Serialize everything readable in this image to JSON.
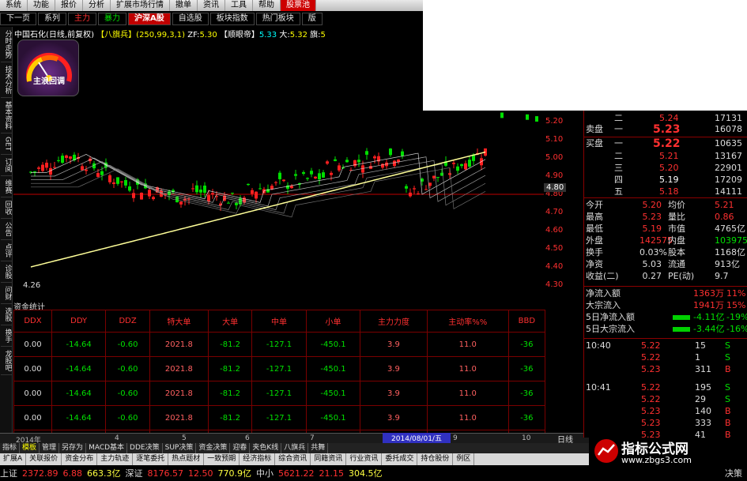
{
  "menu": [
    "系统",
    "功能",
    "报价",
    "分析",
    "扩展市场行情",
    "资讯",
    "工具",
    "帮助",
    "股票池"
  ],
  "menu_extra": [
    "撤单"
  ],
  "tabs": [
    "下一页",
    "系列",
    "自选股",
    "板块指数",
    "热门板块",
    "版"
  ],
  "tab_red": "主力",
  "tab_blue": "暴力",
  "hot_tab": "沪深A股",
  "chart_info": {
    "stock": "中国石化(日线,前复权)",
    "indicator": "【八旗兵】(250,99,3,1)",
    "zf_label": "ZF:",
    "zf_value": "5.30",
    "kai_label": "【顺眼帝】",
    "kai_value": "5.33",
    "big_label": "大:",
    "big_value": "5.32",
    "flag_label": "旗:",
    "flag_value": "5"
  },
  "gauge_label": "主浪回调",
  "left_strip": [
    "分时走势",
    "技术分析",
    "基本资料",
    "GET",
    "订阅",
    "维赛",
    "回收",
    "公告",
    "点评",
    "诊股",
    "问财",
    "选股",
    "换手",
    "龙股吧"
  ],
  "price_scale": [
    "5.20",
    "5.10",
    "5.00",
    "4.90",
    "4.80",
    "4.70",
    "4.60",
    "4.50",
    "4.40",
    "4.30"
  ],
  "price_marker": "4.80",
  "min_price_label": "4.26",
  "fund_header": "资金统计",
  "fund_table": {
    "headers": [
      "DDX",
      "DDY",
      "DDZ",
      "特大单",
      "大单",
      "中单",
      "小单",
      "主力力度",
      "主动率%%",
      "BBD"
    ],
    "rows": [
      [
        "0.00",
        "-14.64",
        "-0.60",
        "2021.8",
        "-81.2",
        "-127.1",
        "-450.1",
        "3.9",
        "11.0",
        "-36"
      ],
      [
        "0.00",
        "-14.64",
        "-0.60",
        "2021.8",
        "-81.2",
        "-127.1",
        "-450.1",
        "3.9",
        "11.0",
        "-36"
      ],
      [
        "0.00",
        "-14.64",
        "-0.60",
        "2021.8",
        "-81.2",
        "-127.1",
        "-450.1",
        "3.9",
        "11.0",
        "-36"
      ],
      [
        "0.00",
        "-14.64",
        "-0.60",
        "2021.8",
        "-81.2",
        "-127.1",
        "-450.1",
        "3.9",
        "11.0",
        "-36"
      ],
      [
        "0.00",
        "-14.64",
        "-0.60",
        "2021.8",
        "-81.2",
        "-127.1",
        "-450.1",
        "3.9",
        "11.0",
        "-36"
      ]
    ]
  },
  "bottom_axis": {
    "year": "2014年",
    "marks": [
      "4",
      "5",
      "6",
      "7",
      "9",
      "10"
    ],
    "date_flag": "2014/08/01/五",
    "period_tab": "日线"
  },
  "tabs2": [
    "指标",
    "模板",
    "管理",
    "另存为",
    "MACD基本",
    "DDE决策",
    "SUP决策",
    "资金决策",
    "迎春",
    "夹色K线",
    "八旗兵",
    "共舞"
  ],
  "tabs3": [
    "扩展A",
    "关联报价",
    "资金分布",
    "主力轨迹",
    "逐笔委托",
    "热点题材",
    "一致预期",
    "经济指标",
    "综合资讯",
    "同籍资讯",
    "行业资讯",
    "委托成交",
    "持仓股份",
    "例区"
  ],
  "ticker": {
    "sh_label": "上证",
    "sh_value": "2372.89",
    "sh_change": "6.88",
    "sh_amount": "663.3亿",
    "sz_label": "深证",
    "sz_value": "8176.57",
    "sz_change": "12.50",
    "sz_amount": "770.9亿",
    "zx_label": "中小",
    "zx_value": "5621.22",
    "zx_change": "21.15",
    "zx_amount": "304.5亿",
    "right_label": "决策"
  },
  "order_book": {
    "sell_label": "卖盘",
    "buy_label": "买盘",
    "sell": [
      {
        "lvl": "二",
        "price": "5.24",
        "vol": "17131"
      },
      {
        "lvl": "一",
        "price": "5.23",
        "vol": "16078"
      }
    ],
    "buy": [
      {
        "lvl": "一",
        "price": "5.22",
        "vol": "10635"
      },
      {
        "lvl": "二",
        "price": "5.21",
        "vol": "13167"
      },
      {
        "lvl": "三",
        "price": "5.20",
        "vol": "22901"
      },
      {
        "lvl": "四",
        "price": "5.19",
        "vol": "17209"
      },
      {
        "lvl": "五",
        "price": "5.18",
        "vol": "14111"
      }
    ]
  },
  "quote": [
    {
      "l1": "今开",
      "v1": "5.20",
      "l2": "均价",
      "v2": "5.21"
    },
    {
      "l1": "最高",
      "v1": "5.23",
      "l2": "量比",
      "v2": "0.86"
    },
    {
      "l1": "最低",
      "v1": "5.19",
      "l2": "市值",
      "v2": "4765亿"
    },
    {
      "l1": "外盘",
      "v1": "142575",
      "l2": "内盘",
      "v2": "103975"
    },
    {
      "l1": "换手",
      "v1": "0.03%",
      "l2": "股本",
      "v2": "1168亿"
    },
    {
      "l1": "净资",
      "v1": "5.03",
      "l2": "流通",
      "v2": "913亿"
    },
    {
      "l1": "收益(二)",
      "v1": "0.27",
      "l2": "PE(动)",
      "v2": "9.7"
    }
  ],
  "flows": [
    {
      "label": "净流入额",
      "value": "1363万",
      "pct": "11%"
    },
    {
      "label": "大宗流入",
      "value": "1941万",
      "pct": "15%"
    },
    {
      "label": "5日净流入额",
      "value": "-4.11亿",
      "pct": "-19%"
    },
    {
      "label": "5日大宗流入",
      "value": "-3.44亿",
      "pct": "-16%"
    }
  ],
  "trades": [
    {
      "time": "10:40",
      "price": "5.22",
      "vol": "15",
      "side": "S"
    },
    {
      "time": "",
      "price": "5.22",
      "vol": "1",
      "side": "S"
    },
    {
      "time": "",
      "price": "5.23",
      "vol": "311",
      "side": "B"
    },
    {
      "time": "10:41",
      "price": "5.22",
      "vol": "195",
      "side": "S"
    },
    {
      "time": "",
      "price": "5.22",
      "vol": "29",
      "side": "S"
    },
    {
      "time": "",
      "price": "5.23",
      "vol": "140",
      "side": "B"
    },
    {
      "time": "",
      "price": "5.23",
      "vol": "333",
      "side": "B"
    },
    {
      "time": "",
      "price": "5.23",
      "vol": "41",
      "side": "B"
    }
  ],
  "watermark": {
    "line1": "指标公式网",
    "line2": "www.zbgs3.com"
  }
}
